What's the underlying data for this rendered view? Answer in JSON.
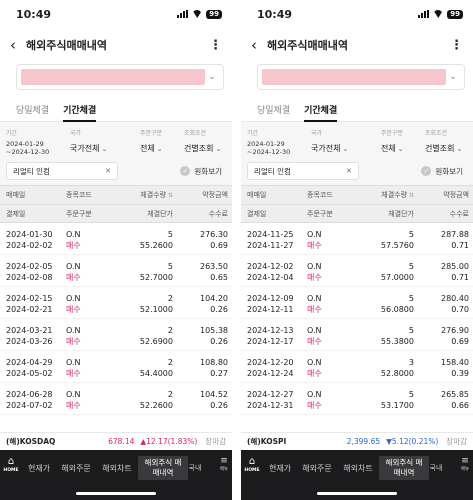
{
  "screens": [
    {
      "status": {
        "time": "10:49",
        "battery": "99"
      },
      "header": {
        "title": "해외주식매매내역"
      },
      "tabs": [
        {
          "label": "당일체결",
          "active": false
        },
        {
          "label": "기간체결",
          "active": true
        }
      ],
      "filters": {
        "labels": {
          "period": "기간",
          "country": "국가",
          "order": "주문구분",
          "cond": "조회조건"
        },
        "period_start": "2024-01-29",
        "period_end": "~2024-12-30",
        "country": "국가전체",
        "order": "전체",
        "cond": "건별조회",
        "symbol": "리얼티 인컴",
        "krw_label": "원화보기"
      },
      "table_header": {
        "row1": [
          "매매일",
          "종목코드",
          "체결수량",
          "약정금액"
        ],
        "row2": [
          "결제일",
          "주문구분",
          "체결단가",
          "수수료"
        ]
      },
      "rows": [
        {
          "trade": "2024-01-30",
          "settle": "2024-02-02",
          "code": "O.N",
          "side": "매수",
          "qty": "5",
          "price": "55.2600",
          "amount": "276.30",
          "fee": "0.69"
        },
        {
          "trade": "2024-02-05",
          "settle": "2024-02-08",
          "code": "O.N",
          "side": "매수",
          "qty": "5",
          "price": "52.7000",
          "amount": "263.50",
          "fee": "0.65"
        },
        {
          "trade": "2024-02-15",
          "settle": "2024-02-21",
          "code": "O.N",
          "side": "매수",
          "qty": "2",
          "price": "52.1000",
          "amount": "104.20",
          "fee": "0.26"
        },
        {
          "trade": "2024-03-21",
          "settle": "2024-03-26",
          "code": "O.N",
          "side": "매수",
          "qty": "2",
          "price": "52.6900",
          "amount": "105.38",
          "fee": "0.26"
        },
        {
          "trade": "2024-04-29",
          "settle": "2024-05-02",
          "code": "O.N",
          "side": "매수",
          "qty": "2",
          "price": "54.4000",
          "amount": "108.80",
          "fee": "0.27"
        },
        {
          "trade": "2024-06-28",
          "settle": "2024-07-02",
          "code": "O.N",
          "side": "매수",
          "qty": "2",
          "price": "52.2600",
          "amount": "104.52",
          "fee": "0.26"
        }
      ],
      "ticker": {
        "name": "(해)KOSDAQ",
        "value": "678.14",
        "change": "▲12.17(1.83%)",
        "direction": "up",
        "market": "장마감"
      },
      "tabbar": {
        "home": "HOME",
        "items": [
          "현재가",
          "해외주문",
          "해외차트"
        ],
        "active": "해외주식 매매내역",
        "partial": "국내",
        "menu": "메뉴"
      }
    },
    {
      "status": {
        "time": "10:49",
        "battery": "99"
      },
      "header": {
        "title": "해외주식매매내역"
      },
      "tabs": [
        {
          "label": "당일체결",
          "active": false
        },
        {
          "label": "기간체결",
          "active": true
        }
      ],
      "filters": {
        "labels": {
          "period": "기간",
          "country": "국가",
          "order": "주문구분",
          "cond": "조회조건"
        },
        "period_start": "2024-01-29",
        "period_end": "~2024-12-30",
        "country": "국가전체",
        "order": "전체",
        "cond": "건별조회",
        "symbol": "리얼티 인컴",
        "krw_label": "원화보기"
      },
      "table_header": {
        "row1": [
          "매매일",
          "종목코드",
          "체결수량",
          "약정금액"
        ],
        "row2": [
          "결제일",
          "주문구분",
          "체결단가",
          "수수료"
        ]
      },
      "rows": [
        {
          "trade": "2024-11-25",
          "settle": "2024-11-27",
          "code": "O.N",
          "side": "매수",
          "qty": "5",
          "price": "57.5760",
          "amount": "287.88",
          "fee": "0.71"
        },
        {
          "trade": "2024-12-02",
          "settle": "2024-12-04",
          "code": "O.N",
          "side": "매수",
          "qty": "5",
          "price": "57.0000",
          "amount": "285.00",
          "fee": "0.71"
        },
        {
          "trade": "2024-12-09",
          "settle": "2024-12-11",
          "code": "O.N",
          "side": "매수",
          "qty": "5",
          "price": "56.0800",
          "amount": "280.40",
          "fee": "0.70"
        },
        {
          "trade": "2024-12-13",
          "settle": "2024-12-17",
          "code": "O.N",
          "side": "매수",
          "qty": "5",
          "price": "55.3800",
          "amount": "276.90",
          "fee": "0.69"
        },
        {
          "trade": "2024-12-20",
          "settle": "2024-12-24",
          "code": "O.N",
          "side": "매수",
          "qty": "3",
          "price": "52.8000",
          "amount": "158.40",
          "fee": "0.39"
        },
        {
          "trade": "2024-12-27",
          "settle": "2024-12-31",
          "code": "O.N",
          "side": "매수",
          "qty": "5",
          "price": "53.1700",
          "amount": "265.85",
          "fee": "0.66"
        }
      ],
      "ticker": {
        "name": "(해)KOSPI",
        "value": "2,399.65",
        "change": "▼5.12(0.21%)",
        "direction": "down",
        "market": "장마감"
      },
      "tabbar": {
        "home": "HOME",
        "items": [
          "현재가",
          "해외주문",
          "해외차트"
        ],
        "active": "해외주식 매매내역",
        "partial": "국내",
        "menu": "메뉴"
      }
    }
  ]
}
